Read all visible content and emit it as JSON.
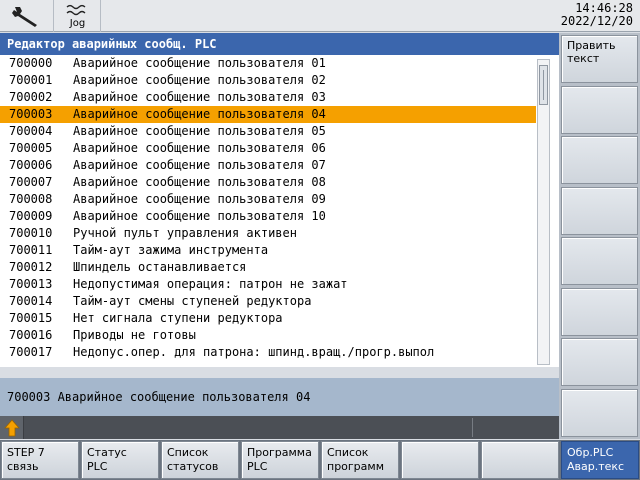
{
  "topbar": {
    "wrench_icon": "wrench-icon",
    "jog_icon": "jog-wave-icon",
    "jog_label": "Jog",
    "time": "14:46:28",
    "date": "2022/12/20"
  },
  "title": "Редактор аварийных сообщ. PLC",
  "alarms": [
    {
      "num": "700000",
      "text": "Аварийное сообщение пользователя 01"
    },
    {
      "num": "700001",
      "text": "Аварийное сообщение пользователя 02"
    },
    {
      "num": "700002",
      "text": "Аварийное сообщение пользователя 03"
    },
    {
      "num": "700003",
      "text": "Аварийное сообщение пользователя 04"
    },
    {
      "num": "700004",
      "text": "Аварийное сообщение пользователя 05"
    },
    {
      "num": "700005",
      "text": "Аварийное сообщение пользователя 06"
    },
    {
      "num": "700006",
      "text": "Аварийное сообщение пользователя 07"
    },
    {
      "num": "700007",
      "text": "Аварийное сообщение пользователя 08"
    },
    {
      "num": "700008",
      "text": "Аварийное сообщение пользователя 09"
    },
    {
      "num": "700009",
      "text": "Аварийное сообщение пользователя 10"
    },
    {
      "num": "700010",
      "text": "Ручной пульт управления активен"
    },
    {
      "num": "700011",
      "text": "Тайм-аут зажима инструмента"
    },
    {
      "num": "700012",
      "text": "Шпиндель останавливается"
    },
    {
      "num": "700013",
      "text": "Недопустимая операция: патрон не зажат"
    },
    {
      "num": "700014",
      "text": "Тайм-аут смены ступеней редуктора"
    },
    {
      "num": "700015",
      "text": "Нет сигнала ступени редуктора"
    },
    {
      "num": "700016",
      "text": "Приводы не готовы"
    },
    {
      "num": "700017",
      "text": "Недопус.опер. для патрона: шпинд.вращ./прогр.выпол"
    }
  ],
  "selected_index": 3,
  "info_text": "700003 Аварийное сообщение пользователя 04",
  "recall_icon": "up-arrow-recall-icon",
  "vertical_softkeys": [
    {
      "line1": "Править",
      "line2": "текст"
    },
    {
      "line1": "",
      "line2": ""
    },
    {
      "line1": "",
      "line2": ""
    },
    {
      "line1": "",
      "line2": ""
    },
    {
      "line1": "",
      "line2": ""
    },
    {
      "line1": "",
      "line2": ""
    },
    {
      "line1": "",
      "line2": ""
    },
    {
      "line1": "",
      "line2": ""
    }
  ],
  "horizontal_softkeys": [
    {
      "line1": "STEP 7",
      "line2": "связь",
      "active": false
    },
    {
      "line1": "Статус",
      "line2": "PLC",
      "active": false
    },
    {
      "line1": "Список",
      "line2": "статусов",
      "active": false
    },
    {
      "line1": "Программа",
      "line2": "PLC",
      "active": false
    },
    {
      "line1": "Список",
      "line2": "программ",
      "active": false
    },
    {
      "line1": "",
      "line2": "",
      "active": false
    },
    {
      "line1": "",
      "line2": "",
      "active": false
    },
    {
      "line1": "Обр.PLC",
      "line2": "Авар.текс",
      "active": true
    }
  ],
  "colors": {
    "title_bar": "#3b66ad",
    "selection": "#f5a000",
    "info_bar": "#a5b7cc",
    "recall_arrow": "#f5a000"
  }
}
